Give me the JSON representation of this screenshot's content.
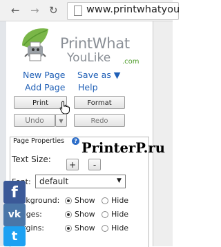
{
  "browser": {
    "url": "www.printwhatyou",
    "back_icon": "arrow-left",
    "forward_icon": "arrow-right",
    "reload_icon": "reload"
  },
  "logo": {
    "line1": "PrintWhat",
    "line2": "YouLike",
    "suffix": ".com"
  },
  "links": {
    "new_page": "New Page",
    "add_page": "Add Page",
    "save_as": "Save as ▼",
    "help": "Help"
  },
  "buttons": {
    "print": "Print",
    "format": "Format",
    "undo": "Undo",
    "undo_dropdown": "▼",
    "redo": "Redo"
  },
  "page_properties": {
    "legend": "Page Properties",
    "help_symbol": "?",
    "text_size_label": "Text Size:",
    "increase": "+",
    "decrease": "-",
    "font_label": "Font:",
    "font_value": "default",
    "rows": [
      {
        "label": "Background:",
        "show": "Show",
        "hide": "Hide"
      },
      {
        "label": "Images:",
        "show": "Show",
        "hide": "Hide"
      },
      {
        "label": "Margins:",
        "show": "Show",
        "hide": "Hide"
      }
    ]
  },
  "watermark": "PrinterP.ru",
  "social": {
    "facebook": "f",
    "vk": "vk",
    "twitter": "t"
  },
  "colors": {
    "link": "#1f5fb6",
    "facebook": "#3b5998",
    "vk": "#4a76a8",
    "twitter": "#1da1f2"
  }
}
